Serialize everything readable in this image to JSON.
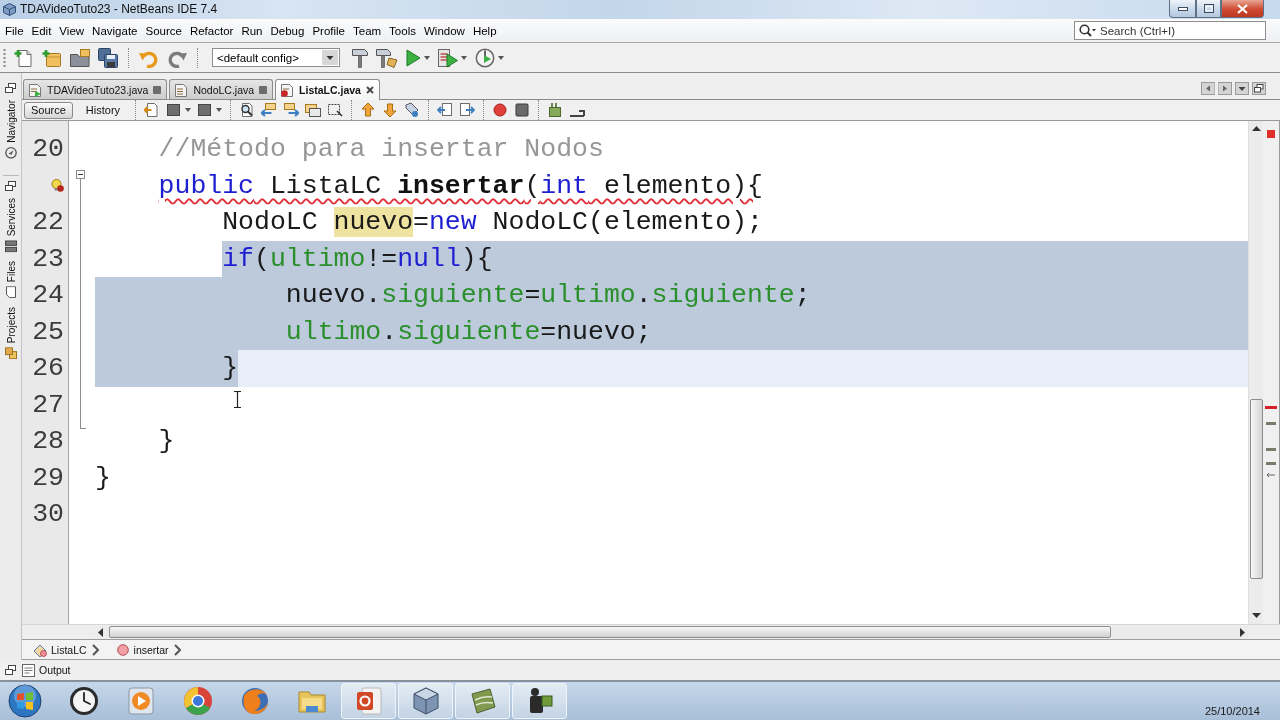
{
  "window": {
    "title": "TDAVideoTuto23 - NetBeans IDE 7.4"
  },
  "menu_bar": {
    "items": [
      "File",
      "Edit",
      "View",
      "Navigate",
      "Source",
      "Refactor",
      "Run",
      "Debug",
      "Profile",
      "Team",
      "Tools",
      "Window",
      "Help"
    ],
    "search": {
      "placeholder": "Search (Ctrl+I)"
    }
  },
  "toolbar": {
    "config": "<default config>"
  },
  "side_panels": [
    {
      "tabs": [
        {
          "label": "Navigator",
          "kind": "navigator"
        }
      ]
    },
    {
      "tabs": [
        {
          "label": "Services",
          "kind": "services"
        },
        {
          "label": "Files",
          "kind": "files"
        },
        {
          "label": "Projects",
          "kind": "projects"
        }
      ]
    }
  ],
  "editor_tabs": [
    {
      "label": "TDAVideoTuto23.java",
      "kind": "main_class",
      "selected": false
    },
    {
      "label": "NodoLC.java",
      "kind": "class",
      "selected": false
    },
    {
      "label": "ListaLC.java",
      "kind": "error_class",
      "selected": true
    }
  ],
  "editor_views": [
    {
      "label": "Source",
      "selected": true
    },
    {
      "label": "History",
      "selected": false
    }
  ],
  "code": {
    "class_body": [
      {
        "number": "20",
        "tokens": [
          {
            "kind": "comment",
            "text": "//Método para insertar Nodos"
          }
        ],
        "selected": false,
        "current": false,
        "error": false,
        "hint": false
      },
      {
        "tokens": [
          {
            "kind": "keyword",
            "text": "public"
          },
          {
            "kind": "plain",
            "text": " ListaLC "
          },
          {
            "kind": "method",
            "text": "insertar"
          },
          {
            "kind": "plain",
            "text": "("
          },
          {
            "kind": "keyword",
            "text": "int"
          },
          {
            "kind": "plain",
            "text": " elemento){"
          }
        ],
        "expanded": true,
        "selected": false,
        "current": false,
        "error": true,
        "hint": true,
        "children": [
          {
            "number": "22",
            "tokens": [
              {
                "kind": "plain",
                "text": "NodoLC "
              },
              {
                "kind": "marked",
                "text": "nuevo"
              },
              {
                "kind": "plain",
                "text": "="
              },
              {
                "kind": "keyword",
                "text": "new"
              },
              {
                "kind": "plain",
                "text": " NodoLC(elemento);"
              }
            ],
            "selected": false,
            "current": false,
            "error": false,
            "hint": false
          },
          {
            "number": "23",
            "tokens": [
              {
                "kind": "keyword",
                "text": "if"
              },
              {
                "kind": "plain",
                "text": "("
              },
              {
                "kind": "field",
                "text": "ultimo"
              },
              {
                "kind": "plain",
                "text": "!="
              },
              {
                "kind": "keyword",
                "text": "null"
              },
              {
                "kind": "plain",
                "text": "){"
              }
            ],
            "selected": true,
            "current": false,
            "error": false,
            "hint": false,
            "children": [
              {
                "number": "24",
                "tokens": [
                  {
                    "kind": "plain",
                    "text": "nuevo."
                  },
                  {
                    "kind": "field",
                    "text": "siguiente"
                  },
                  {
                    "kind": "plain",
                    "text": "="
                  },
                  {
                    "kind": "field",
                    "text": "ultimo"
                  },
                  {
                    "kind": "plain",
                    "text": "."
                  },
                  {
                    "kind": "field",
                    "text": "siguiente"
                  },
                  {
                    "kind": "plain",
                    "text": ";"
                  }
                ],
                "selected": true,
                "current": false,
                "error": false,
                "hint": false
              },
              {
                "number": "25",
                "tokens": [
                  {
                    "kind": "field",
                    "text": "ultimo"
                  },
                  {
                    "kind": "plain",
                    "text": "."
                  },
                  {
                    "kind": "field",
                    "text": "siguiente"
                  },
                  {
                    "kind": "plain",
                    "text": "=nuevo;"
                  }
                ],
                "selected": true,
                "current": false,
                "error": false,
                "hint": false
              }
            ]
          },
          {
            "number": "26",
            "tokens": [
              {
                "kind": "plain",
                "text": "}"
              }
            ],
            "selected": true,
            "current": true,
            "error": false,
            "hint": false
          },
          {
            "number": "27",
            "selected": false,
            "current": false,
            "error": false,
            "hint": false
          }
        ]
      },
      {
        "number": "28",
        "tokens": [
          {
            "kind": "plain",
            "text": "}"
          }
        ],
        "selected": false,
        "current": false,
        "error": false,
        "hint": false
      }
    ],
    "class_end": [
      {
        "number": "29",
        "tokens": [
          {
            "kind": "plain",
            "text": "}"
          }
        ],
        "selected": false,
        "current": false,
        "error": false,
        "hint": false
      },
      {
        "number": "30",
        "selected": false,
        "current": false,
        "error": false,
        "hint": false
      }
    ]
  },
  "breadcrumbs": [
    {
      "label": "ListaLC",
      "kind": "class"
    },
    {
      "label": "insertar",
      "kind": "method"
    }
  ],
  "output_bar": {
    "label": "Output"
  },
  "taskbar": {
    "apps": [
      {
        "kind": "clock",
        "running": false
      },
      {
        "kind": "player",
        "running": false
      },
      {
        "kind": "ring_logo",
        "running": false
      },
      {
        "kind": "globe",
        "running": false
      },
      {
        "kind": "folder",
        "running": false
      },
      {
        "kind": "presentation",
        "running": true
      },
      {
        "kind": "cube",
        "running": true
      },
      {
        "kind": "map",
        "running": true
      },
      {
        "kind": "camera",
        "running": true
      }
    ],
    "date": "25/10/2014"
  }
}
